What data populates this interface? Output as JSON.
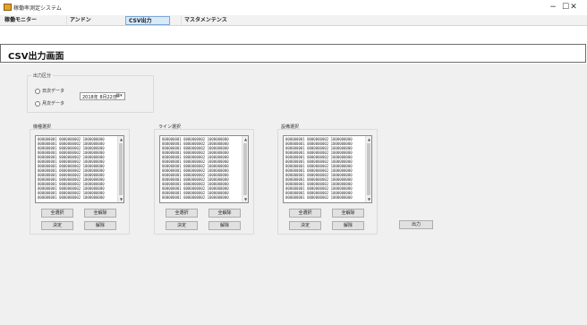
{
  "window": {
    "title": "稼働率測定システム",
    "controls": {
      "minimize": "−",
      "maximize": "☐",
      "close": "✕"
    }
  },
  "menu": [
    {
      "label": "稼働モニター",
      "active": false
    },
    {
      "label": "アンドン",
      "active": false
    },
    {
      "label": "CSV出力",
      "active": true
    },
    {
      "label": "マスタメンテンス",
      "active": false
    }
  ],
  "page": {
    "title": "CSV出力画面"
  },
  "output_type": {
    "group_label": "出力区分",
    "options": [
      {
        "label": "日次データ",
        "selected": false
      },
      {
        "label": "月次データ",
        "selected": false
      }
    ],
    "date_value": "2018年 8月22日",
    "date_button": "▦▾"
  },
  "panels": [
    {
      "label": "機種選択",
      "items": [
        "000000001 0000000002 1000000000",
        "000000001 0000000002 1000000000",
        "000000001 0000000002 1000000000",
        "000000001 0000000002 1000000000",
        "000000001 0000000002 1000000000",
        "000000001 0000000002 1000000000",
        "000000001 0000000002 1000000000",
        "000000001 0000000002 1000000000",
        "000000001 0000000002 1000000000",
        "000000001 0000000002 1000000000",
        "000000001 0000000002 1000000000",
        "000000001 0000000002 1000000000",
        "000000001 0000000002 1000000000",
        "000000001 0000000002 1000000000"
      ],
      "buttons": {
        "select_all": "全選択",
        "clear_all": "全解除",
        "confirm": "決定",
        "release": "解除"
      }
    },
    {
      "label": "ライン選択",
      "items": [
        "000000001 0000000002 1000000000",
        "000000001 0000000002 1000000000",
        "000000001 0000000002 1000000000",
        "000000001 0000000002 1000000000",
        "000000001 0000000002 1000000000",
        "000000001 0000000002 1000000000",
        "000000001 0000000002 1000000000",
        "000000001 0000000002 1000000000",
        "000000001 0000000002 1000000000",
        "000000001 0000000002 1000000000",
        "000000001 0000000002 1000000000",
        "000000001 0000000002 1000000000",
        "000000001 0000000002 1000000000",
        "000000001 0000000002 1000000000"
      ],
      "buttons": {
        "select_all": "全選択",
        "clear_all": "全解除",
        "confirm": "決定",
        "release": "解除"
      }
    },
    {
      "label": "設備選択",
      "items": [
        "000000001 0000000002 1000000000",
        "000000001 0000000002 1000000000",
        "000000001 0000000002 1000000000",
        "000000001 0000000002 1000000000",
        "000000001 0000000002 1000000000",
        "000000001 0000000002 1000000000",
        "000000001 0000000002 1000000000",
        "000000001 0000000002 1000000000",
        "000000001 0000000002 1000000000",
        "000000001 0000000002 1000000000",
        "000000001 0000000002 1000000000",
        "000000001 0000000002 1000000000",
        "000000001 0000000002 1000000000",
        "000000001 0000000002 1000000000"
      ],
      "buttons": {
        "select_all": "全選択",
        "clear_all": "全解除",
        "confirm": "決定",
        "release": "解除"
      }
    }
  ],
  "output_button": "出力",
  "scroll": {
    "up": "▲",
    "down": "▼"
  }
}
